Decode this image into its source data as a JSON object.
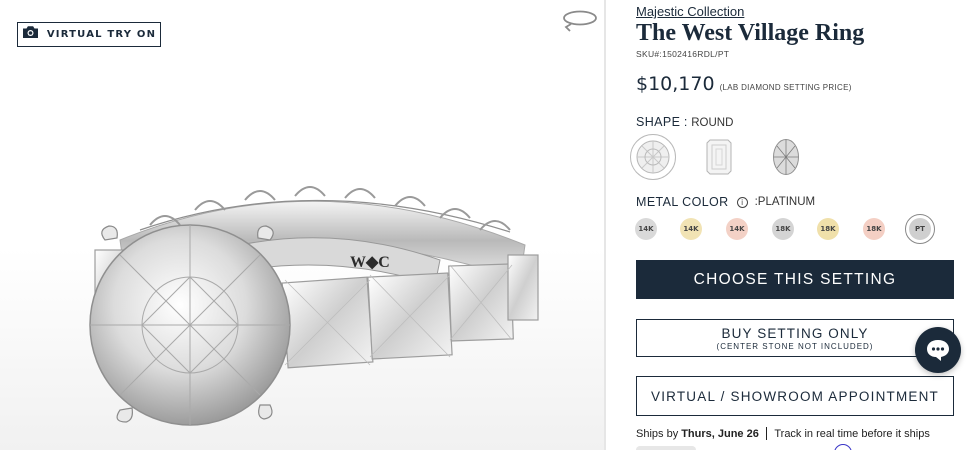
{
  "gallery": {
    "try_on_label": "VIRTUAL TRY ON",
    "engraving": "W◆C"
  },
  "product": {
    "collection": "Majestic Collection",
    "title": "The West Village Ring",
    "sku": "SKU#:1502416RDL/PT",
    "price": "$10,170",
    "price_note": "(LAB DIAMOND SETTING PRICE)"
  },
  "shape": {
    "label": "SHAPE",
    "separator": ":",
    "selected": "ROUND",
    "options": [
      {
        "name": "round",
        "selected": true
      },
      {
        "name": "emerald",
        "selected": false
      },
      {
        "name": "oval",
        "selected": false
      }
    ]
  },
  "metal": {
    "label": "METAL COLOR",
    "info_glyph": "i",
    "selected": ":PLATINUM",
    "swatches": [
      {
        "label": "14K",
        "color": "#d9d9d9",
        "selected": false
      },
      {
        "label": "14K",
        "color": "#f1e3b4",
        "selected": false
      },
      {
        "label": "14K",
        "color": "#f3d1c6",
        "selected": false
      },
      {
        "label": "18K",
        "color": "#d4d4d4",
        "selected": false
      },
      {
        "label": "18K",
        "color": "#f0e0aa",
        "selected": false
      },
      {
        "label": "18K",
        "color": "#f4cfc4",
        "selected": false
      },
      {
        "label": "PT",
        "color": "#cfcfcf",
        "selected": true
      }
    ]
  },
  "actions": {
    "choose": "CHOOSE THIS SETTING",
    "buy_main": "BUY SETTING ONLY",
    "buy_sub": "(CENTER STONE NOT INCLUDED)",
    "appointment": "VIRTUAL / SHOWROOM APPOINTMENT"
  },
  "shipping": {
    "prefix": "Ships by",
    "date": "Thurs, June 26",
    "tracking": "Track in real time before it ships"
  },
  "colors": {
    "navy": "#1b2a3a",
    "divider": "#e6e6e6",
    "accent_ring": "#3a36c7"
  },
  "icons": {
    "camera": "camera-icon",
    "rotate": "rotate-360-icon",
    "info": "info-icon",
    "chat": "chat-icon"
  }
}
